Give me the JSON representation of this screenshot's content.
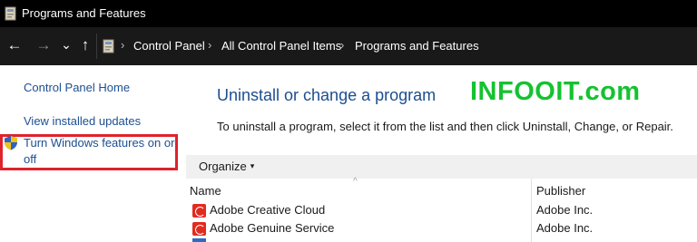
{
  "window": {
    "title": "Programs and Features"
  },
  "navigation": {
    "back_glyph": "←",
    "forward_glyph": "→",
    "recent_glyph": "⌄",
    "up_glyph": "↑",
    "breadcrumbs": [
      "Control Panel",
      "All Control Panel Items",
      "Programs and Features"
    ],
    "separator_glyph": "›"
  },
  "sidebar": {
    "home_label": "Control Panel Home",
    "updates_label": "View installed updates",
    "features_label_line1": "Turn Windows features on or",
    "features_label_line2": "off",
    "highlight_color": "#e0222b"
  },
  "main": {
    "heading": "Uninstall or change a program",
    "watermark": "INFOOIT.com",
    "description": "To uninstall a program, select it from the list and then click Uninstall, Change, or Repair.",
    "organize_label": "Organize",
    "organize_caret": "▾",
    "columns": [
      "Name",
      "Publisher"
    ],
    "sort_glyph": "^",
    "programs": [
      {
        "name": "Adobe Creative Cloud",
        "publisher": "Adobe Inc."
      },
      {
        "name": "Adobe Genuine Service",
        "publisher": "Adobe Inc."
      }
    ]
  },
  "colors": {
    "link": "#1d4f91",
    "heading": "#1c4e8f",
    "watermark": "#15c230",
    "titlebar": "#000000",
    "addressbar": "#191919"
  },
  "icons": [
    "control-panel-icon",
    "back-arrow-icon",
    "forward-arrow-icon",
    "chevron-down-icon",
    "up-arrow-icon",
    "uac-shield-icon",
    "adobe-icon"
  ]
}
